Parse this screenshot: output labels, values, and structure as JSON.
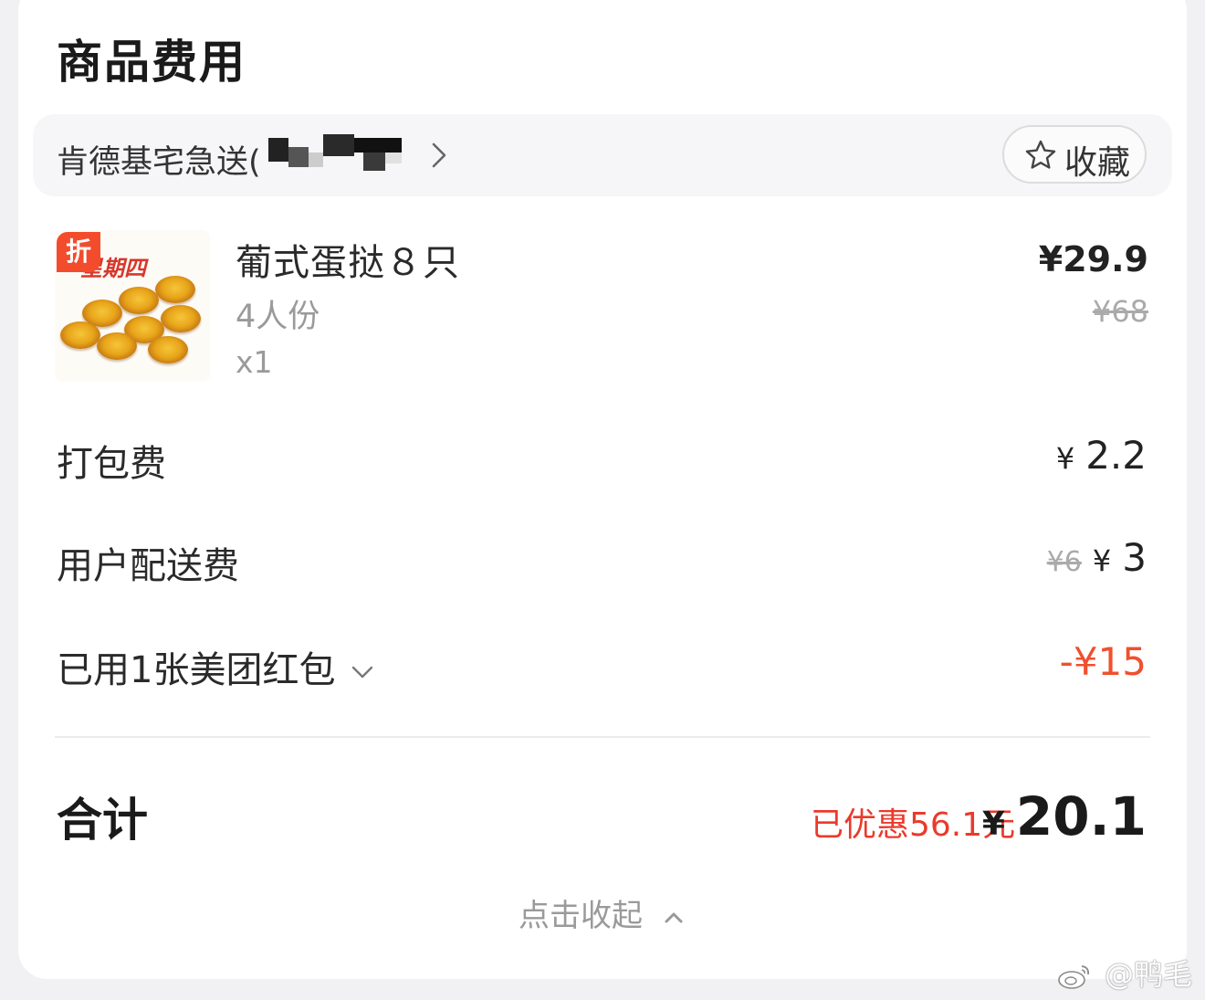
{
  "section_title": "商品费用",
  "shop": {
    "name": "肯德基宅急送(",
    "favorite_label": "收藏"
  },
  "item": {
    "badge": "折",
    "banner": "星期四",
    "name": "葡式蛋挞８只",
    "spec": "4人份",
    "qty": "x1",
    "price": "¥29.9",
    "original_price": "¥68"
  },
  "fees": {
    "packing": {
      "label": "打包费",
      "currency": "¥",
      "amount": "2.2"
    },
    "delivery": {
      "label": "用户配送费",
      "original": "¥6",
      "currency": "¥",
      "amount": "3"
    },
    "coupon": {
      "label": "已用1张美团红包",
      "amount": "-¥15"
    }
  },
  "total": {
    "label": "合计",
    "saved": "已优惠56.1元",
    "currency": "¥",
    "amount": "20.1"
  },
  "collapse_label": "点击收起",
  "watermark": "@鸭毛",
  "colors": {
    "accent_red": "#f0502e",
    "badge_red": "#f24c2c"
  }
}
